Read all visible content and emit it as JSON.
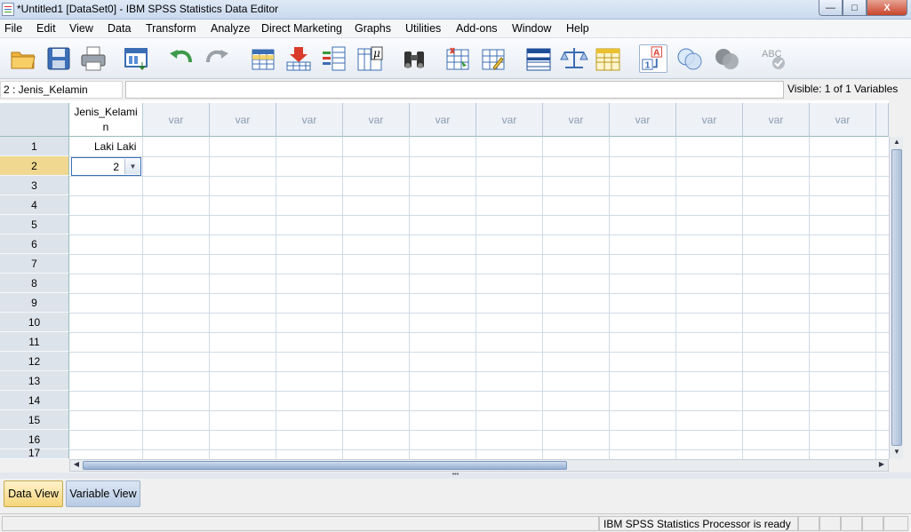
{
  "window": {
    "title": "*Untitled1 [DataSet0] - IBM SPSS Statistics Data Editor",
    "minimize_label": "—",
    "maximize_label": "□",
    "close_label": "X"
  },
  "menu": [
    {
      "label": "File"
    },
    {
      "label": "Edit"
    },
    {
      "label": "View"
    },
    {
      "label": "Data"
    },
    {
      "label": "Transform"
    },
    {
      "label": "Analyze"
    },
    {
      "label": "Direct Marketing"
    },
    {
      "label": "Graphs"
    },
    {
      "label": "Utilities"
    },
    {
      "label": "Add-ons"
    },
    {
      "label": "Window"
    },
    {
      "label": "Help"
    }
  ],
  "toolbar": {
    "icons": [
      "open-folder-icon",
      "save-icon",
      "print-icon",
      "recall-dialog-icon",
      "undo-icon",
      "redo-icon",
      "goto-case-icon",
      "goto-variable-icon",
      "variables-icon",
      "value-labels-mu-icon",
      "find-binoculars-icon",
      "insert-cases-icon",
      "insert-variable-icon",
      "split-file-icon",
      "weight-cases-icon",
      "select-cases-icon",
      "value-labels-icon",
      "use-sets-icon",
      "show-all-variables-icon",
      "spell-check-icon"
    ],
    "value_labels_text_top": "A",
    "value_labels_text_bottom": "1",
    "mu_text": "μ",
    "spell_text": "ABC"
  },
  "cell_bar": {
    "reference": "2 : Jenis_Kelamin",
    "editor_value": "",
    "visible_text": "Visible: 1 of 1 Variables"
  },
  "grid": {
    "columns": [
      {
        "label": "Jenis_Kelami n",
        "line1": "Jenis_Kelami",
        "line2": "n"
      },
      {
        "label": "var"
      },
      {
        "label": "var"
      },
      {
        "label": "var"
      },
      {
        "label": "var"
      },
      {
        "label": "var"
      },
      {
        "label": "var"
      },
      {
        "label": "var"
      },
      {
        "label": "var"
      },
      {
        "label": "var"
      },
      {
        "label": "var"
      },
      {
        "label": "var"
      }
    ],
    "rows": [
      "1",
      "2",
      "3",
      "4",
      "5",
      "6",
      "7",
      "8",
      "9",
      "10",
      "11",
      "12",
      "13",
      "14",
      "15",
      "16",
      "17"
    ],
    "selected_row": "2",
    "cells": {
      "r1c1": "Laki Laki",
      "r2c1_editing": "2"
    }
  },
  "tabs": [
    {
      "label": "Data View",
      "active": true
    },
    {
      "label": "Variable View",
      "active": false
    }
  ],
  "status": {
    "processor": "IBM SPSS Statistics Processor is ready"
  },
  "colors": {
    "selected_row_header": "#f0d890",
    "active_tab": "#f6d57a",
    "inactive_tab": "#b8cbe5",
    "grid_line": "#d0dbe6"
  }
}
